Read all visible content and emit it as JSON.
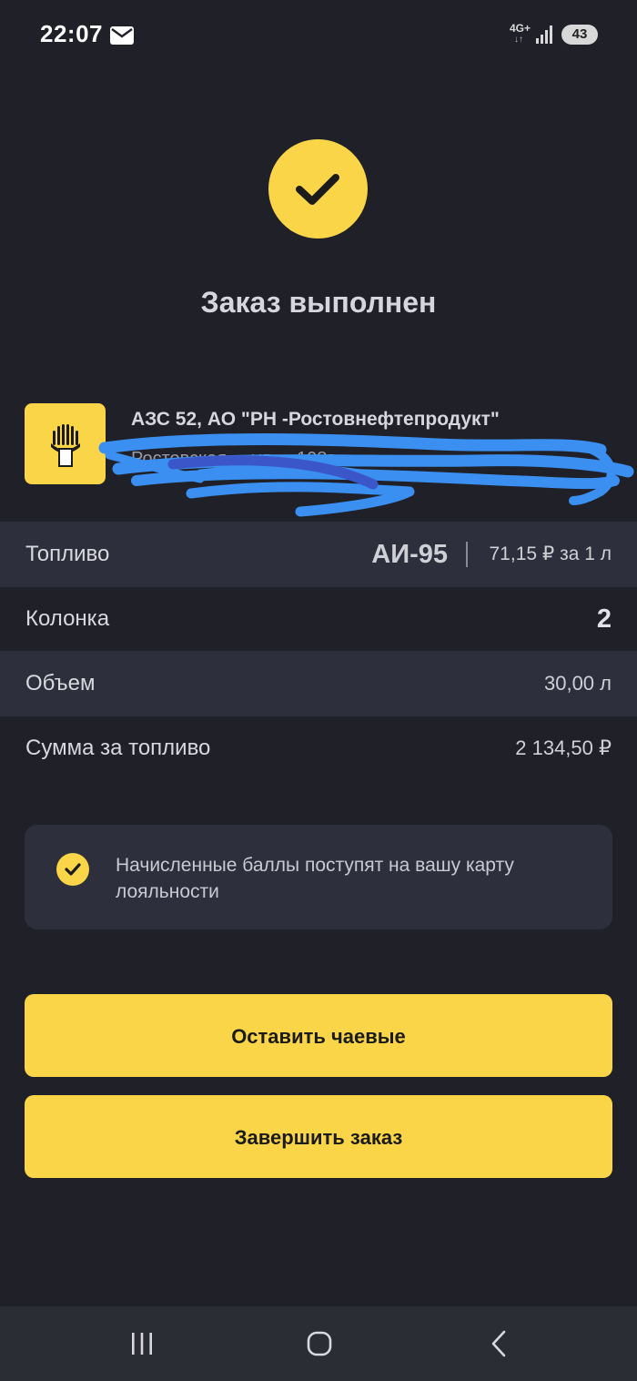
{
  "status_bar": {
    "time": "22:07",
    "network": "4G+",
    "network_arrows": "↓↑",
    "battery": "43",
    "icons": [
      "mail-icon",
      "signal-icon",
      "battery-icon"
    ]
  },
  "header": {
    "status_icon": "check-circle-icon",
    "title": "Заказ выполнен"
  },
  "station": {
    "name": "АЗС 52, АО \"РН -Ростовнефтепродукт\"",
    "address": "Ростовская ... ул ... 108в",
    "logo_icon": "rosneft-logo-icon"
  },
  "details": {
    "fuel": {
      "label": "Топливо",
      "value": "АИ-95",
      "price": "71,15 ₽ за 1 л"
    },
    "pump": {
      "label": "Колонка",
      "value": "2"
    },
    "volume": {
      "label": "Объем",
      "value": "30,00 л"
    },
    "total": {
      "label": "Сумма за топливо",
      "value": "2 134,50 ₽"
    }
  },
  "info": {
    "icon": "check-icon",
    "text": "Начисленные баллы поступят на вашу карту лояльности"
  },
  "actions": {
    "tip_label": "Оставить чаевые",
    "finish_label": "Завершить заказ"
  },
  "colors": {
    "background": "#1f2028",
    "accent": "#f9d547",
    "row_alt": "#2d303c",
    "scribble": "#3a8ff0"
  },
  "nav": {
    "icons": [
      "recents-icon",
      "home-icon",
      "back-icon"
    ]
  }
}
